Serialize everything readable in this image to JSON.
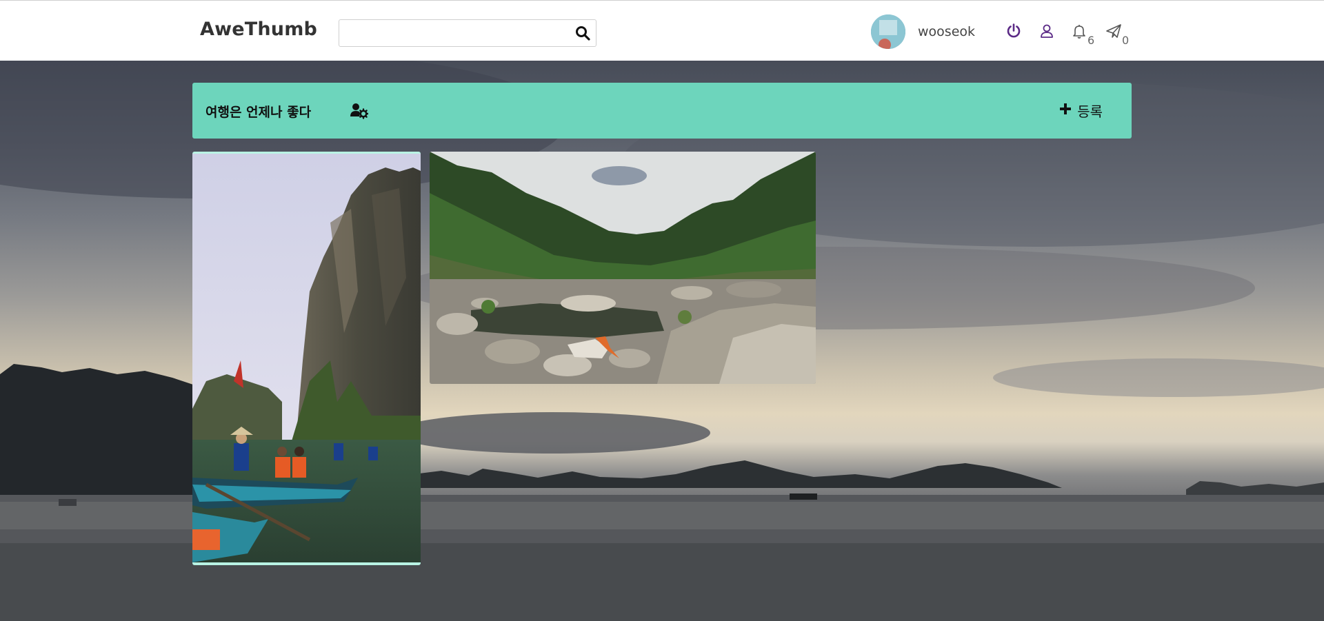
{
  "app": {
    "logo": "AweThumb"
  },
  "search": {
    "value": "",
    "placeholder": "",
    "icon": "search-icon"
  },
  "user": {
    "name": "wooseok"
  },
  "nav": {
    "logout_icon": "power-icon",
    "profile_icon": "user-icon",
    "notifications_icon": "bell-icon",
    "notifications_count": "6",
    "messages_icon": "paper-plane-icon",
    "messages_count": "0"
  },
  "board": {
    "title": "여행은 언제나 좋다",
    "settings_icon": "user-gear-icon",
    "add_icon": "plus-icon",
    "add_label": "등록"
  },
  "colors": {
    "header_bg": "#6dd5bc",
    "accent_purple": "#5b2a86",
    "card_border": "#b9f3e4"
  },
  "posts": [
    {
      "thumb": "limestone-cliff-boats-photo"
    },
    {
      "thumb": "rocky-river-valley-photo"
    }
  ]
}
